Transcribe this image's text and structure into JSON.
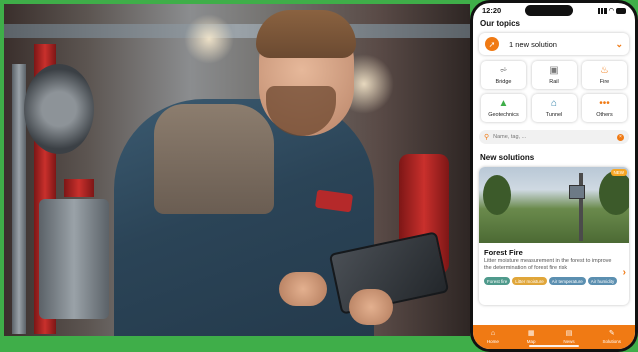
{
  "status": {
    "time": "12:20"
  },
  "topics": {
    "title": "Our topics",
    "solution_label": "1 new solution",
    "items": [
      {
        "label": "Bridge",
        "icon": "bridge-icon",
        "color": "#7a7a7a"
      },
      {
        "label": "Rail",
        "icon": "rail-icon",
        "color": "#7a7a7a"
      },
      {
        "label": "Fire",
        "icon": "fire-icon",
        "color": "#f07a14"
      },
      {
        "label": "Geotechnics",
        "icon": "geotechnics-icon",
        "color": "#3fae49"
      },
      {
        "label": "Tunnel",
        "icon": "tunnel-icon",
        "color": "#2f7fa8"
      },
      {
        "label": "Others",
        "icon": "more-dots-icon",
        "color": "#f07a14"
      }
    ]
  },
  "search": {
    "placeholder": "Name, tag, ..."
  },
  "new_solutions": {
    "title": "New solutions",
    "card": {
      "badge": "NEW",
      "title": "Forest Fire",
      "description": "Litter moisture measurement in the forest to improve the determination of forest fire risk",
      "tags": [
        {
          "label": "Forest fire",
          "color": "#4f9a8c"
        },
        {
          "label": "Litter moisture",
          "color": "#e0a63a"
        },
        {
          "label": "Air temperature",
          "color": "#5b8fb0"
        },
        {
          "label": "Air humidity",
          "color": "#5b8fb0"
        }
      ]
    }
  },
  "tabbar": {
    "items": [
      {
        "label": "Home",
        "icon": "home-icon"
      },
      {
        "label": "Map",
        "icon": "map-icon"
      },
      {
        "label": "News",
        "icon": "news-icon"
      },
      {
        "label": "Solutions",
        "icon": "solutions-icon"
      }
    ]
  },
  "colors": {
    "accent": "#f07a14",
    "frame": "#3fae49"
  }
}
